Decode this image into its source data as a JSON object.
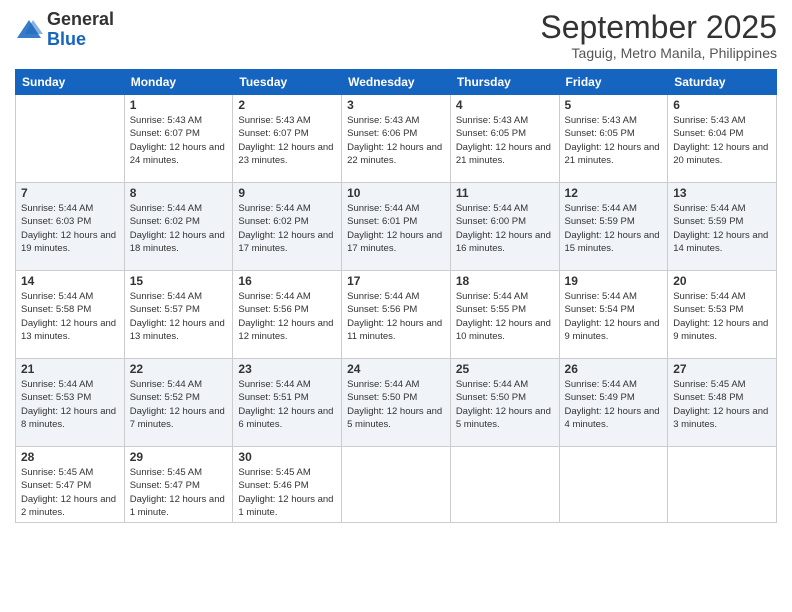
{
  "logo": {
    "general": "General",
    "blue": "Blue"
  },
  "title": "September 2025",
  "subtitle": "Taguig, Metro Manila, Philippines",
  "days": [
    "Sunday",
    "Monday",
    "Tuesday",
    "Wednesday",
    "Thursday",
    "Friday",
    "Saturday"
  ],
  "weeks": [
    [
      {
        "num": "",
        "sunrise": "",
        "sunset": "",
        "daylight": ""
      },
      {
        "num": "1",
        "sunrise": "Sunrise: 5:43 AM",
        "sunset": "Sunset: 6:07 PM",
        "daylight": "Daylight: 12 hours and 24 minutes."
      },
      {
        "num": "2",
        "sunrise": "Sunrise: 5:43 AM",
        "sunset": "Sunset: 6:07 PM",
        "daylight": "Daylight: 12 hours and 23 minutes."
      },
      {
        "num": "3",
        "sunrise": "Sunrise: 5:43 AM",
        "sunset": "Sunset: 6:06 PM",
        "daylight": "Daylight: 12 hours and 22 minutes."
      },
      {
        "num": "4",
        "sunrise": "Sunrise: 5:43 AM",
        "sunset": "Sunset: 6:05 PM",
        "daylight": "Daylight: 12 hours and 21 minutes."
      },
      {
        "num": "5",
        "sunrise": "Sunrise: 5:43 AM",
        "sunset": "Sunset: 6:05 PM",
        "daylight": "Daylight: 12 hours and 21 minutes."
      },
      {
        "num": "6",
        "sunrise": "Sunrise: 5:43 AM",
        "sunset": "Sunset: 6:04 PM",
        "daylight": "Daylight: 12 hours and 20 minutes."
      }
    ],
    [
      {
        "num": "7",
        "sunrise": "Sunrise: 5:44 AM",
        "sunset": "Sunset: 6:03 PM",
        "daylight": "Daylight: 12 hours and 19 minutes."
      },
      {
        "num": "8",
        "sunrise": "Sunrise: 5:44 AM",
        "sunset": "Sunset: 6:02 PM",
        "daylight": "Daylight: 12 hours and 18 minutes."
      },
      {
        "num": "9",
        "sunrise": "Sunrise: 5:44 AM",
        "sunset": "Sunset: 6:02 PM",
        "daylight": "Daylight: 12 hours and 17 minutes."
      },
      {
        "num": "10",
        "sunrise": "Sunrise: 5:44 AM",
        "sunset": "Sunset: 6:01 PM",
        "daylight": "Daylight: 12 hours and 17 minutes."
      },
      {
        "num": "11",
        "sunrise": "Sunrise: 5:44 AM",
        "sunset": "Sunset: 6:00 PM",
        "daylight": "Daylight: 12 hours and 16 minutes."
      },
      {
        "num": "12",
        "sunrise": "Sunrise: 5:44 AM",
        "sunset": "Sunset: 5:59 PM",
        "daylight": "Daylight: 12 hours and 15 minutes."
      },
      {
        "num": "13",
        "sunrise": "Sunrise: 5:44 AM",
        "sunset": "Sunset: 5:59 PM",
        "daylight": "Daylight: 12 hours and 14 minutes."
      }
    ],
    [
      {
        "num": "14",
        "sunrise": "Sunrise: 5:44 AM",
        "sunset": "Sunset: 5:58 PM",
        "daylight": "Daylight: 12 hours and 13 minutes."
      },
      {
        "num": "15",
        "sunrise": "Sunrise: 5:44 AM",
        "sunset": "Sunset: 5:57 PM",
        "daylight": "Daylight: 12 hours and 13 minutes."
      },
      {
        "num": "16",
        "sunrise": "Sunrise: 5:44 AM",
        "sunset": "Sunset: 5:56 PM",
        "daylight": "Daylight: 12 hours and 12 minutes."
      },
      {
        "num": "17",
        "sunrise": "Sunrise: 5:44 AM",
        "sunset": "Sunset: 5:56 PM",
        "daylight": "Daylight: 12 hours and 11 minutes."
      },
      {
        "num": "18",
        "sunrise": "Sunrise: 5:44 AM",
        "sunset": "Sunset: 5:55 PM",
        "daylight": "Daylight: 12 hours and 10 minutes."
      },
      {
        "num": "19",
        "sunrise": "Sunrise: 5:44 AM",
        "sunset": "Sunset: 5:54 PM",
        "daylight": "Daylight: 12 hours and 9 minutes."
      },
      {
        "num": "20",
        "sunrise": "Sunrise: 5:44 AM",
        "sunset": "Sunset: 5:53 PM",
        "daylight": "Daylight: 12 hours and 9 minutes."
      }
    ],
    [
      {
        "num": "21",
        "sunrise": "Sunrise: 5:44 AM",
        "sunset": "Sunset: 5:53 PM",
        "daylight": "Daylight: 12 hours and 8 minutes."
      },
      {
        "num": "22",
        "sunrise": "Sunrise: 5:44 AM",
        "sunset": "Sunset: 5:52 PM",
        "daylight": "Daylight: 12 hours and 7 minutes."
      },
      {
        "num": "23",
        "sunrise": "Sunrise: 5:44 AM",
        "sunset": "Sunset: 5:51 PM",
        "daylight": "Daylight: 12 hours and 6 minutes."
      },
      {
        "num": "24",
        "sunrise": "Sunrise: 5:44 AM",
        "sunset": "Sunset: 5:50 PM",
        "daylight": "Daylight: 12 hours and 5 minutes."
      },
      {
        "num": "25",
        "sunrise": "Sunrise: 5:44 AM",
        "sunset": "Sunset: 5:50 PM",
        "daylight": "Daylight: 12 hours and 5 minutes."
      },
      {
        "num": "26",
        "sunrise": "Sunrise: 5:44 AM",
        "sunset": "Sunset: 5:49 PM",
        "daylight": "Daylight: 12 hours and 4 minutes."
      },
      {
        "num": "27",
        "sunrise": "Sunrise: 5:45 AM",
        "sunset": "Sunset: 5:48 PM",
        "daylight": "Daylight: 12 hours and 3 minutes."
      }
    ],
    [
      {
        "num": "28",
        "sunrise": "Sunrise: 5:45 AM",
        "sunset": "Sunset: 5:47 PM",
        "daylight": "Daylight: 12 hours and 2 minutes."
      },
      {
        "num": "29",
        "sunrise": "Sunrise: 5:45 AM",
        "sunset": "Sunset: 5:47 PM",
        "daylight": "Daylight: 12 hours and 1 minute."
      },
      {
        "num": "30",
        "sunrise": "Sunrise: 5:45 AM",
        "sunset": "Sunset: 5:46 PM",
        "daylight": "Daylight: 12 hours and 1 minute."
      },
      {
        "num": "",
        "sunrise": "",
        "sunset": "",
        "daylight": ""
      },
      {
        "num": "",
        "sunrise": "",
        "sunset": "",
        "daylight": ""
      },
      {
        "num": "",
        "sunrise": "",
        "sunset": "",
        "daylight": ""
      },
      {
        "num": "",
        "sunrise": "",
        "sunset": "",
        "daylight": ""
      }
    ]
  ]
}
